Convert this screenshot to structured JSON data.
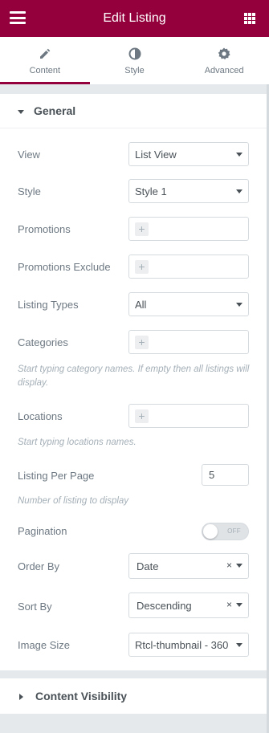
{
  "header": {
    "title": "Edit Listing",
    "menu_icon": "hamburger-icon",
    "apps_icon": "grid-icon"
  },
  "tabs": [
    {
      "label": "Content",
      "icon": "pencil-icon",
      "active": true
    },
    {
      "label": "Style",
      "icon": "contrast-icon",
      "active": false
    },
    {
      "label": "Advanced",
      "icon": "gear-icon",
      "active": false
    }
  ],
  "general": {
    "title": "General",
    "view": {
      "label": "View",
      "value": "List View"
    },
    "style": {
      "label": "Style",
      "value": "Style 1"
    },
    "promotions": {
      "label": "Promotions"
    },
    "promotions_exclude": {
      "label": "Promotions Exclude"
    },
    "listing_types": {
      "label": "Listing Types",
      "value": "All"
    },
    "categories": {
      "label": "Categories",
      "hint": "Start typing category names. If empty then all listings will display."
    },
    "locations": {
      "label": "Locations",
      "hint": "Start typing locations names."
    },
    "listing_per_page": {
      "label": "Listing Per Page",
      "value": "5",
      "hint": "Number of listing to display"
    },
    "pagination": {
      "label": "Pagination",
      "state": "OFF"
    },
    "order_by": {
      "label": "Order By",
      "value": "Date"
    },
    "sort_by": {
      "label": "Sort By",
      "value": "Descending"
    },
    "image_size": {
      "label": "Image Size",
      "value": "Rtcl-thumbnail - 360"
    }
  },
  "content_visibility": {
    "title": "Content Visibility"
  },
  "colors": {
    "brand": "#93003c",
    "panel": "#ffffff",
    "background": "#e6e9ec"
  }
}
